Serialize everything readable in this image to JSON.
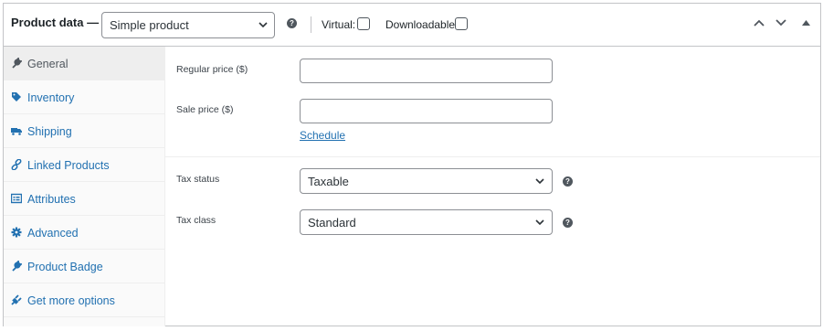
{
  "header": {
    "title": "Product data —",
    "product_type": "Simple product",
    "virtual_label": "Virtual:",
    "downloadable_label": "Downloadable:",
    "help_glyph": "?"
  },
  "sidebar": {
    "items": [
      {
        "label": "General",
        "icon": "wrench-icon",
        "active": true
      },
      {
        "label": "Inventory",
        "icon": "tag-icon",
        "active": false
      },
      {
        "label": "Shipping",
        "icon": "truck-icon",
        "active": false
      },
      {
        "label": "Linked Products",
        "icon": "link-icon",
        "active": false
      },
      {
        "label": "Attributes",
        "icon": "list-icon",
        "active": false
      },
      {
        "label": "Advanced",
        "icon": "gear-icon",
        "active": false
      },
      {
        "label": "Product Badge",
        "icon": "wrench-icon",
        "active": false
      },
      {
        "label": "Get more options",
        "icon": "plugin-icon",
        "active": false
      }
    ]
  },
  "general": {
    "regular_price_label": "Regular price ($)",
    "regular_price_value": "",
    "sale_price_label": "Sale price ($)",
    "sale_price_value": "",
    "schedule_link": "Schedule",
    "tax_status_label": "Tax status",
    "tax_status_value": "Taxable",
    "tax_class_label": "Tax class",
    "tax_class_value": "Standard"
  },
  "colors": {
    "link": "#2271b1",
    "border": "#c3c4c7",
    "active_tab": "#eeeeee"
  }
}
